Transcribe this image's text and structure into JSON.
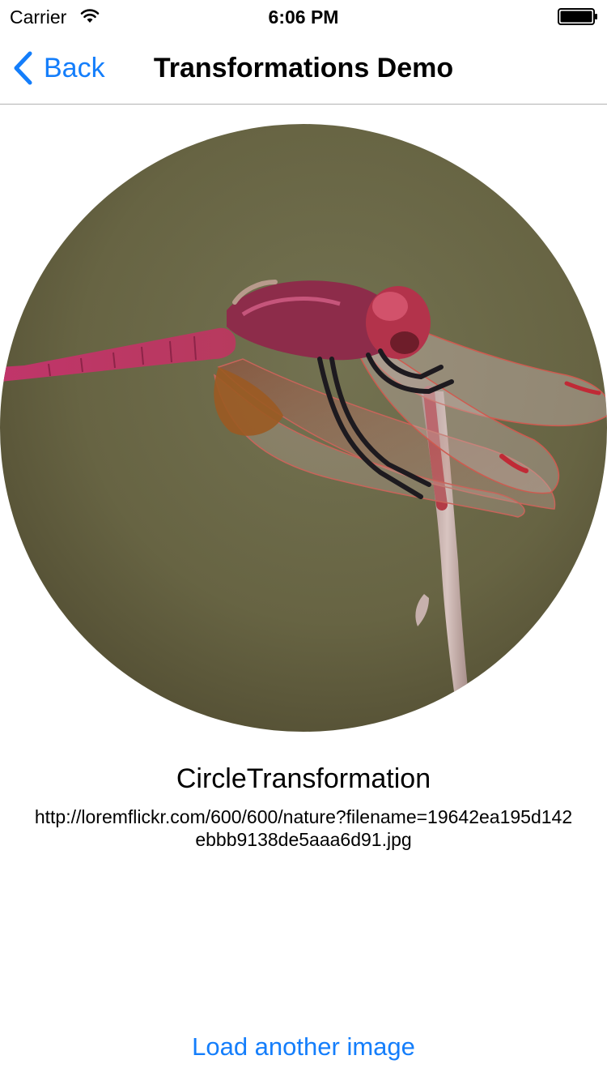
{
  "status_bar": {
    "carrier": "Carrier",
    "time": "6:06 PM",
    "wifi_icon": "wifi-icon",
    "battery_icon": "battery-full-icon"
  },
  "nav": {
    "back_label": "Back",
    "back_icon": "chevron-left-icon",
    "title": "Transformations Demo"
  },
  "content": {
    "image_subject": "dragonfly-photo",
    "transformation_name": "CircleTransformation",
    "image_url": "http://loremflickr.com/600/600/nature?filename=19642ea195d142ebbb9138de5aaa6d91.jpg"
  },
  "footer": {
    "load_button_label": "Load another image"
  },
  "colors": {
    "accent": "#147efb",
    "nav_divider": "#b2b2b2",
    "photo_background": "#6b6a48"
  }
}
